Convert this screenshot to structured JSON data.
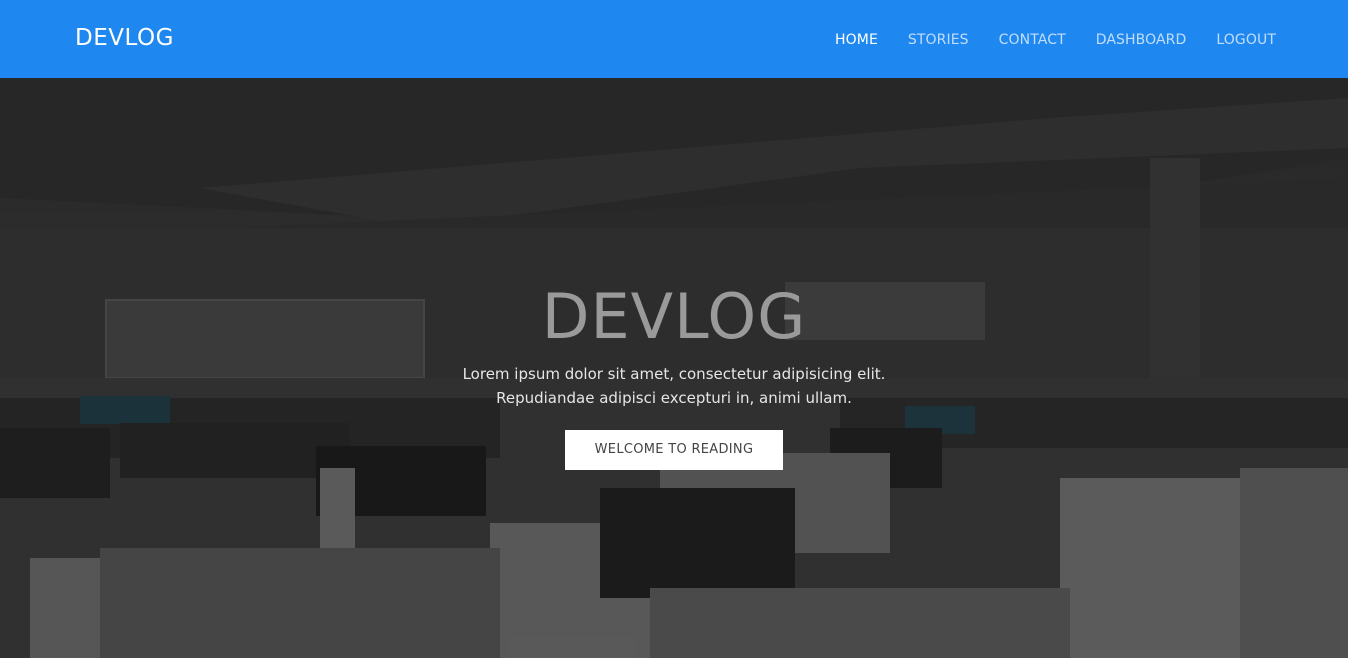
{
  "navbar": {
    "brand": "DEVLOG",
    "items": [
      {
        "label": "HOME",
        "active": true
      },
      {
        "label": "STORIES",
        "active": false
      },
      {
        "label": "CONTACT",
        "active": false
      },
      {
        "label": "DASHBOARD",
        "active": false
      },
      {
        "label": "LOGOUT",
        "active": false
      }
    ]
  },
  "hero": {
    "title": "DEVLOG",
    "line1": "Lorem ipsum dolor sit amet, consectetur adipisicing elit.",
    "line2": "Repudiandae adipisci excepturi in, animi ullam.",
    "button_label": "WELCOME TO READING"
  },
  "colors": {
    "navbar_bg": "#1e87f0",
    "button_bg": "#ffffff"
  }
}
